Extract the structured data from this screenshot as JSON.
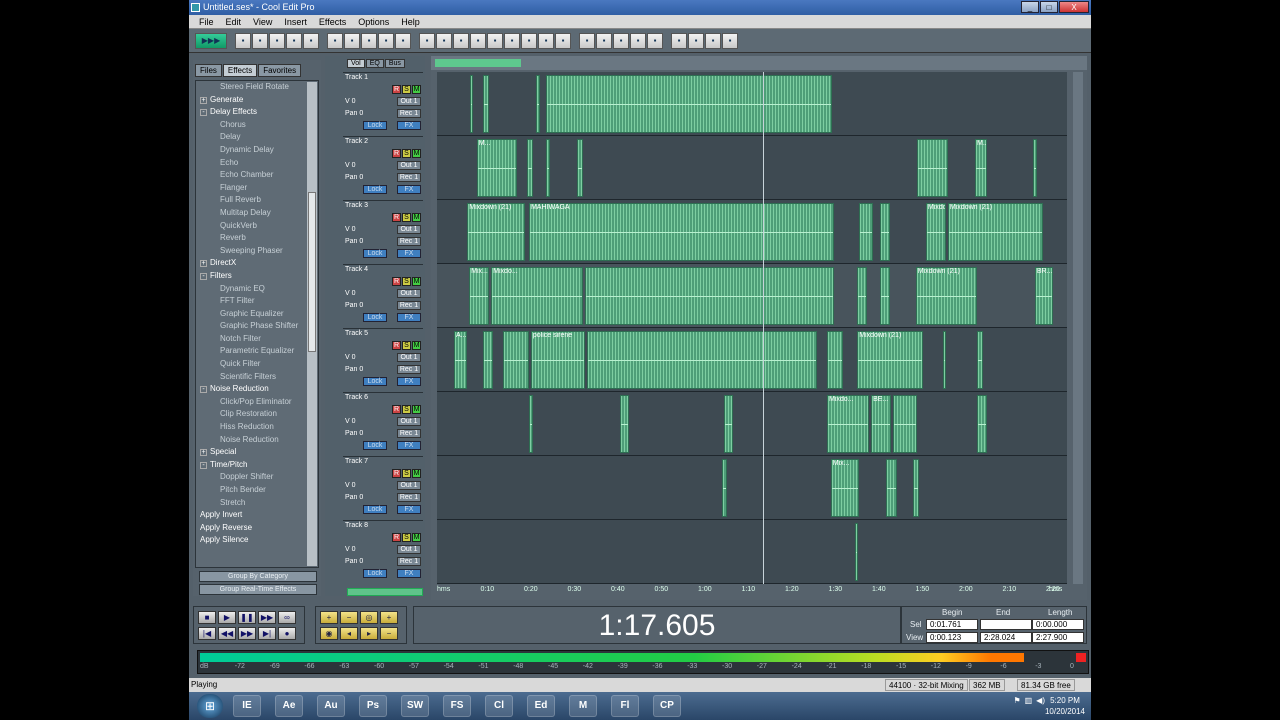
{
  "window": {
    "title": "Untitled.ses* - Cool Edit Pro",
    "buttons": [
      "_",
      "□",
      "X"
    ]
  },
  "menu": [
    "File",
    "Edit",
    "View",
    "Insert",
    "Effects",
    "Options",
    "Help"
  ],
  "toolbar_icons": [
    "play-icon",
    "new-icon",
    "open-icon",
    "save-icon",
    "save-all-icon",
    "print-icon",
    "cut-icon",
    "copy-icon",
    "paste-icon",
    "undo-icon",
    "redo-icon",
    "mix-icon",
    "split-icon",
    "trim-icon",
    "fade-icon",
    "envelope-icon",
    "zoom-icon",
    "snap-icon",
    "loop-icon",
    "mixdown-icon",
    "wave-icon",
    "wet-icon",
    "fx-icon",
    "bpm-icon",
    "cd-icon",
    "record-icon",
    "properties-icon",
    "settings-icon",
    "help-icon"
  ],
  "left_panel": {
    "tabs": [
      "Files",
      "Effects",
      "Favorites"
    ],
    "active_tab": "Effects",
    "tree": [
      {
        "label": "Stereo Field Rotate",
        "level": 2
      },
      {
        "label": "Generate",
        "level": 1,
        "toggle": "+"
      },
      {
        "label": "Delay Effects",
        "level": 1,
        "toggle": "-"
      },
      {
        "label": "Chorus",
        "level": 2
      },
      {
        "label": "Delay",
        "level": 2
      },
      {
        "label": "Dynamic Delay",
        "level": 2
      },
      {
        "label": "Echo",
        "level": 2
      },
      {
        "label": "Echo Chamber",
        "level": 2
      },
      {
        "label": "Flanger",
        "level": 2
      },
      {
        "label": "Full Reverb",
        "level": 2
      },
      {
        "label": "Multitap Delay",
        "level": 2
      },
      {
        "label": "QuickVerb",
        "level": 2
      },
      {
        "label": "Reverb",
        "level": 2
      },
      {
        "label": "Sweeping Phaser",
        "level": 2
      },
      {
        "label": "DirectX",
        "level": 1,
        "toggle": "+"
      },
      {
        "label": "Filters",
        "level": 1,
        "toggle": "-"
      },
      {
        "label": "Dynamic EQ",
        "level": 2
      },
      {
        "label": "FFT Filter",
        "level": 2
      },
      {
        "label": "Graphic Equalizer",
        "level": 2
      },
      {
        "label": "Graphic Phase Shifter",
        "level": 2
      },
      {
        "label": "Notch Filter",
        "level": 2
      },
      {
        "label": "Parametric Equalizer",
        "level": 2
      },
      {
        "label": "Quick Filter",
        "level": 2
      },
      {
        "label": "Scientific Filters",
        "level": 2
      },
      {
        "label": "Noise Reduction",
        "level": 1,
        "toggle": "-"
      },
      {
        "label": "Click/Pop Eliminator",
        "level": 2
      },
      {
        "label": "Clip Restoration",
        "level": 2
      },
      {
        "label": "Hiss Reduction",
        "level": 2
      },
      {
        "label": "Noise Reduction",
        "level": 2
      },
      {
        "label": "Special",
        "level": 1,
        "toggle": "+"
      },
      {
        "label": "Time/Pitch",
        "level": 1,
        "toggle": "-"
      },
      {
        "label": "Doppler Shifter",
        "level": 2
      },
      {
        "label": "Pitch Bender",
        "level": 2
      },
      {
        "label": "Stretch",
        "level": 2
      },
      {
        "label": "Apply Invert",
        "level": 1
      },
      {
        "label": "Apply Reverse",
        "level": 1
      },
      {
        "label": "Apply Silence",
        "level": 1
      }
    ],
    "group_category": "Group By Category",
    "group_realtime": "Group Real-Time Effects"
  },
  "mixer_tabs": [
    "Vol",
    "EQ",
    "Bus"
  ],
  "mixer_labels": {
    "rec": "R",
    "solo": "S",
    "mute": "M",
    "vol": "V 0",
    "pan": "Pan 0",
    "lock": "Lock",
    "fx": "FX"
  },
  "tracks": [
    {
      "name": "Track 1",
      "out": "Out 1",
      "rec": "Rec 1",
      "num": "1"
    },
    {
      "name": "Track 2",
      "out": "Out 1",
      "rec": "Rec 1",
      "num": "2"
    },
    {
      "name": "Track 3",
      "out": "Out 1",
      "rec": "Rec 1",
      "num": "3"
    },
    {
      "name": "Track 4",
      "out": "Out 1",
      "rec": "Rec 1",
      "num": "4"
    },
    {
      "name": "Track 5",
      "out": "Out 1",
      "rec": "Rec 1",
      "num": "5"
    },
    {
      "name": "Track 6",
      "out": "Out 1",
      "rec": "Rec 1",
      "num": "6"
    },
    {
      "name": "Track 7",
      "out": "Out 1",
      "rec": "Rec 1",
      "num": "7"
    },
    {
      "name": "Track 8",
      "out": "Out 1",
      "rec": "Rec 1",
      "num": "8"
    }
  ],
  "clips": [
    {
      "track": 0,
      "start": 0.052,
      "end": 0.057,
      "label": ""
    },
    {
      "track": 0,
      "start": 0.073,
      "end": 0.083,
      "label": ""
    },
    {
      "track": 0,
      "start": 0.157,
      "end": 0.163,
      "label": ""
    },
    {
      "track": 0,
      "start": 0.173,
      "end": 0.627,
      "label": ""
    },
    {
      "track": 1,
      "start": 0.063,
      "end": 0.127,
      "label": "M..."
    },
    {
      "track": 1,
      "start": 0.143,
      "end": 0.152,
      "label": ""
    },
    {
      "track": 1,
      "start": 0.173,
      "end": 0.179,
      "label": ""
    },
    {
      "track": 1,
      "start": 0.222,
      "end": 0.232,
      "label": ""
    },
    {
      "track": 1,
      "start": 0.762,
      "end": 0.811,
      "label": ""
    },
    {
      "track": 1,
      "start": 0.854,
      "end": 0.873,
      "label": "M..."
    },
    {
      "track": 1,
      "start": 0.946,
      "end": 0.952,
      "label": ""
    },
    {
      "track": 2,
      "start": 0.048,
      "end": 0.14,
      "label": "Mixdown (21)"
    },
    {
      "track": 2,
      "start": 0.146,
      "end": 0.63,
      "label": "MAHIWAGA"
    },
    {
      "track": 2,
      "start": 0.67,
      "end": 0.692,
      "label": ""
    },
    {
      "track": 2,
      "start": 0.703,
      "end": 0.719,
      "label": ""
    },
    {
      "track": 2,
      "start": 0.776,
      "end": 0.808,
      "label": "Mixdo..."
    },
    {
      "track": 2,
      "start": 0.811,
      "end": 0.962,
      "label": "Mixdown (21)"
    },
    {
      "track": 3,
      "start": 0.051,
      "end": 0.083,
      "label": "Mix..."
    },
    {
      "track": 3,
      "start": 0.086,
      "end": 0.232,
      "label": "Mixdo..."
    },
    {
      "track": 3,
      "start": 0.235,
      "end": 0.63,
      "label": ""
    },
    {
      "track": 3,
      "start": 0.667,
      "end": 0.683,
      "label": ""
    },
    {
      "track": 3,
      "start": 0.703,
      "end": 0.719,
      "label": ""
    },
    {
      "track": 3,
      "start": 0.76,
      "end": 0.857,
      "label": "Mixdown (21)"
    },
    {
      "track": 3,
      "start": 0.949,
      "end": 0.978,
      "label": "BR..."
    },
    {
      "track": 4,
      "start": 0.027,
      "end": 0.048,
      "label": "A..."
    },
    {
      "track": 4,
      "start": 0.073,
      "end": 0.089,
      "label": ""
    },
    {
      "track": 4,
      "start": 0.105,
      "end": 0.146,
      "label": ""
    },
    {
      "track": 4,
      "start": 0.149,
      "end": 0.235,
      "label": "police sirene"
    },
    {
      "track": 4,
      "start": 0.238,
      "end": 0.603,
      "label": ""
    },
    {
      "track": 4,
      "start": 0.619,
      "end": 0.644,
      "label": ""
    },
    {
      "track": 4,
      "start": 0.667,
      "end": 0.771,
      "label": "Mixdown (21)"
    },
    {
      "track": 4,
      "start": 0.803,
      "end": 0.808,
      "label": ""
    },
    {
      "track": 4,
      "start": 0.857,
      "end": 0.867,
      "label": ""
    },
    {
      "track": 5,
      "start": 0.146,
      "end": 0.152,
      "label": ""
    },
    {
      "track": 5,
      "start": 0.29,
      "end": 0.305,
      "label": ""
    },
    {
      "track": 5,
      "start": 0.456,
      "end": 0.47,
      "label": ""
    },
    {
      "track": 5,
      "start": 0.619,
      "end": 0.686,
      "label": "Mixdo..."
    },
    {
      "track": 5,
      "start": 0.689,
      "end": 0.721,
      "label": "BE..."
    },
    {
      "track": 5,
      "start": 0.724,
      "end": 0.762,
      "label": ""
    },
    {
      "track": 5,
      "start": 0.857,
      "end": 0.873,
      "label": ""
    },
    {
      "track": 6,
      "start": 0.452,
      "end": 0.46,
      "label": ""
    },
    {
      "track": 6,
      "start": 0.625,
      "end": 0.67,
      "label": "Mix..."
    },
    {
      "track": 6,
      "start": 0.713,
      "end": 0.73,
      "label": ""
    },
    {
      "track": 6,
      "start": 0.756,
      "end": 0.765,
      "label": ""
    },
    {
      "track": 7,
      "start": 0.663,
      "end": 0.668,
      "label": ""
    }
  ],
  "time_ticks": [
    "hms",
    "0:10",
    "0:20",
    "0:30",
    "0:40",
    "0:50",
    "1:00",
    "1:10",
    "1:20",
    "1:30",
    "1:40",
    "1:50",
    "2:00",
    "2:10",
    "2:20",
    "hms"
  ],
  "transport": {
    "row1": [
      "■",
      "▶",
      "❚❚",
      "▶▶",
      "∞"
    ],
    "row2": [
      "|◀",
      "◀◀",
      "▶▶",
      "▶|",
      "●"
    ]
  },
  "zoom_icons": [
    "zoom-in-h-icon",
    "zoom-out-h-icon",
    "zoom-full-icon",
    "zoom-in-v-icon",
    "zoom-sel-icon",
    "zoom-left-icon",
    "zoom-right-icon",
    "zoom-out-v-icon"
  ],
  "time_display": "1:17.605",
  "selview": {
    "headers": [
      "Begin",
      "End",
      "Length"
    ],
    "sel_label": "Sel",
    "view_label": "View",
    "sel_begin": "0:01.761",
    "sel_end": "",
    "sel_length": "0:00.000",
    "view_begin": "0:00.123",
    "view_end": "2:28.024",
    "view_length": "2:27.900"
  },
  "meter": {
    "level": 0.945,
    "scale": [
      "dB",
      "-72",
      "-69",
      "-66",
      "-63",
      "-60",
      "-57",
      "-54",
      "-51",
      "-48",
      "-45",
      "-42",
      "-39",
      "-36",
      "-33",
      "-30",
      "-27",
      "-24",
      "-21",
      "-18",
      "-15",
      "-12",
      "-9",
      "-6",
      "-3",
      "0"
    ]
  },
  "status": {
    "state": "Playing",
    "format": "44100 · 32-bit Mixing",
    "memory": "362 MB",
    "disk": "81.34 GB free"
  },
  "taskbar": {
    "apps": [
      "IE",
      "Ae",
      "Au",
      "Ps",
      "SW",
      "FS",
      "Cl",
      "Ed",
      "M",
      "Fl",
      "CP"
    ],
    "time": "5:20 PM",
    "date": "10/20/2014"
  }
}
